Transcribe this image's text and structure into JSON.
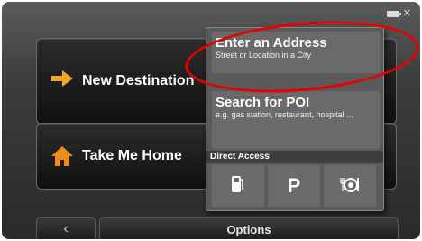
{
  "main": {
    "new_destination_label": "New Destination",
    "take_me_home_label": "Take Me Home",
    "options_label": "Options",
    "back_icon_char": "‹"
  },
  "popup": {
    "enter_address_title": "Enter an Address",
    "enter_address_sub": "Street or Location in a City",
    "search_poi_title": "Search for POI",
    "search_poi_sub": "e.g. gas station, restaurant, hospital ...",
    "direct_access_label": "Direct Access",
    "parking_label": "P"
  },
  "icons": {
    "arrow": "arrow-right-icon",
    "home": "home-icon",
    "fuel": "fuel-pump-icon",
    "food": "restaurant-icon",
    "battery": "battery-icon",
    "satellite": "satellite-icon"
  },
  "colors": {
    "highlight": "#e60000",
    "arrow": "#f5a623",
    "home": "#f08c1e"
  }
}
